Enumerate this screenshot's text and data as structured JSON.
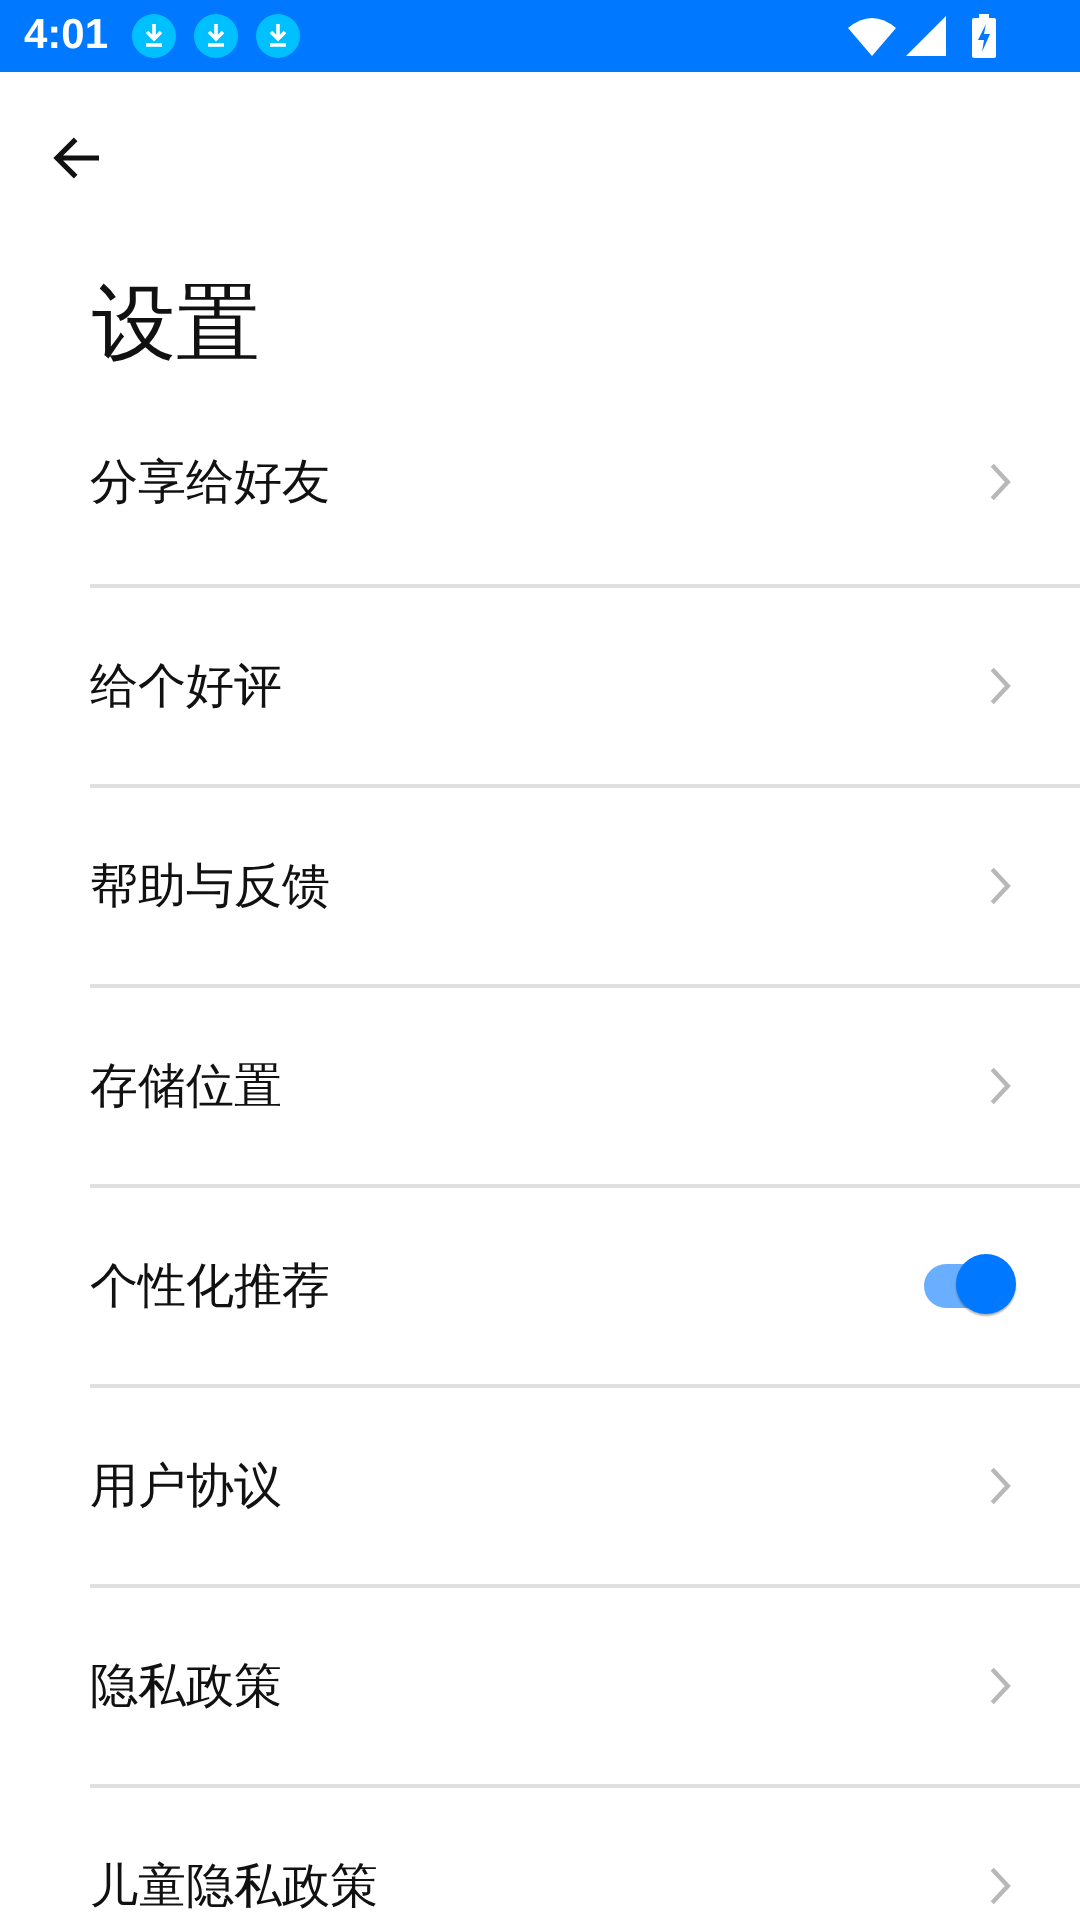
{
  "status_bar": {
    "time": "4:01",
    "notification_icons": [
      {
        "kind": "download"
      },
      {
        "kind": "download"
      },
      {
        "kind": "download"
      }
    ]
  },
  "title": "设置",
  "items": [
    {
      "label": "分享给好友",
      "kind": "link"
    },
    {
      "label": "给个好评",
      "kind": "link"
    },
    {
      "label": "帮助与反馈",
      "kind": "link"
    },
    {
      "label": "存储位置",
      "kind": "link"
    },
    {
      "label": "个性化推荐",
      "kind": "toggle",
      "on": true
    },
    {
      "label": "用户协议",
      "kind": "link"
    },
    {
      "label": "隐私政策",
      "kind": "link"
    },
    {
      "label": "儿童隐私政策",
      "kind": "link"
    }
  ]
}
